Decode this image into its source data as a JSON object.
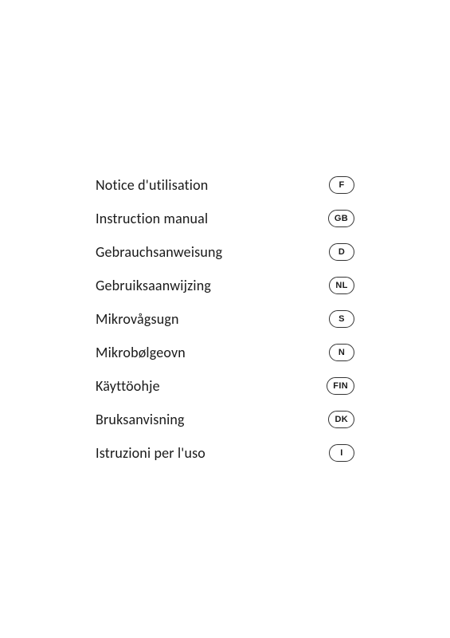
{
  "manuals": {
    "items": [
      {
        "label": "Notice d'utilisation",
        "badge": "F"
      },
      {
        "label": "Instruction manual",
        "badge": "GB"
      },
      {
        "label": "Gebrauchsanweisung",
        "badge": "D"
      },
      {
        "label": "Gebruiksaanwijzing",
        "badge": "NL"
      },
      {
        "label": "Mikrovågsugn",
        "badge": "S"
      },
      {
        "label": "Mikrobølgeovn",
        "badge": "N"
      },
      {
        "label": "Käyttöohje",
        "badge": "FIN"
      },
      {
        "label": "Bruksanvisning",
        "badge": "DK"
      },
      {
        "label": "Istruzioni per l'uso",
        "badge": "I"
      }
    ]
  }
}
